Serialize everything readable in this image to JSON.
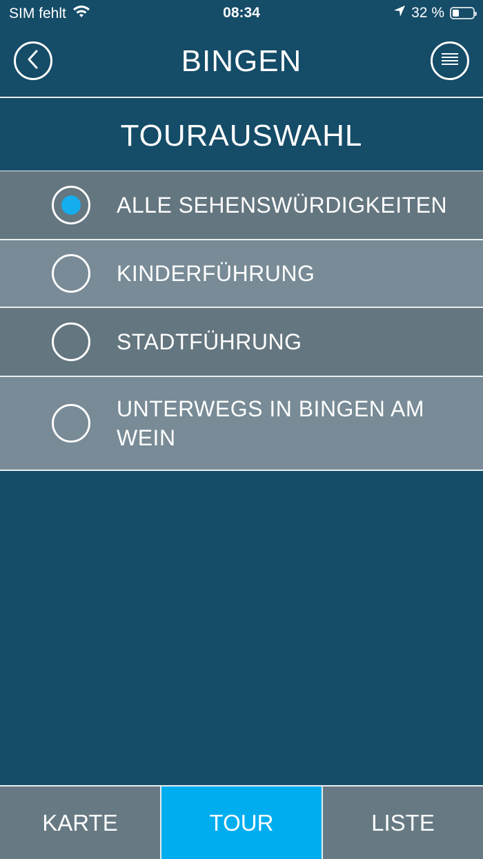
{
  "status_bar": {
    "carrier": "SIM fehlt",
    "time": "08:34",
    "battery": "32 %",
    "battery_level": 0.32
  },
  "nav": {
    "title": "BINGEN",
    "back_icon": "back-chevron-icon",
    "menu_icon": "menu-icon"
  },
  "section": {
    "title": "TOURAUSWAHL"
  },
  "tours": [
    {
      "label": "ALLE SEHENSWÜRDIGKEITEN",
      "selected": true
    },
    {
      "label": "KINDERFÜHRUNG",
      "selected": false
    },
    {
      "label": "STADTFÜHRUNG",
      "selected": false
    },
    {
      "label": "UNTERWEGS IN BINGEN AM WEIN",
      "selected": false
    }
  ],
  "tabs": [
    {
      "label": "KARTE",
      "active": false
    },
    {
      "label": "TOUR",
      "active": true
    },
    {
      "label": "LISTE",
      "active": false
    }
  ],
  "colors": {
    "background": "#154c68",
    "row_dark": "#647680",
    "row_light": "#788b96",
    "accent": "#00adef"
  }
}
